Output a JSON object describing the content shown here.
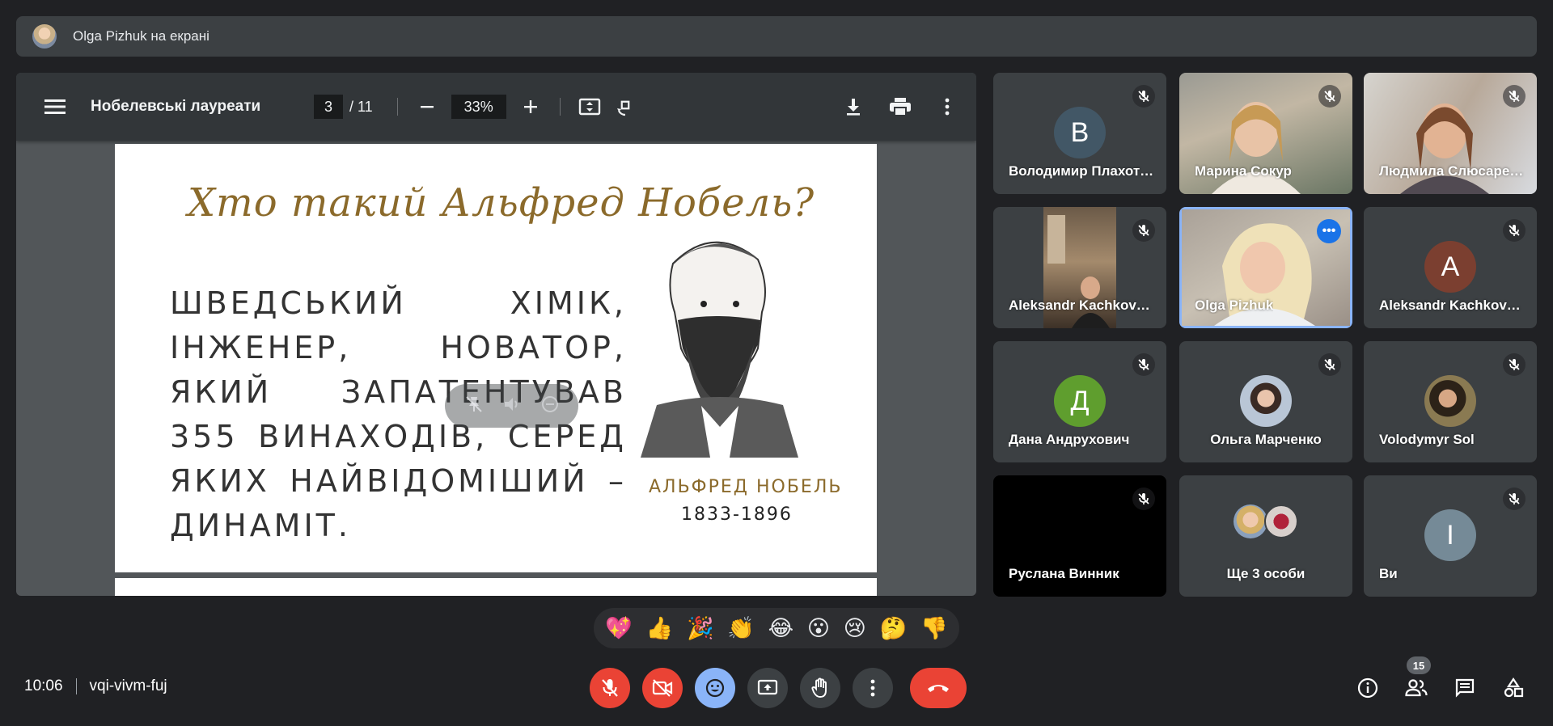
{
  "presenter": {
    "text": "Olga Pizhuk на екрані"
  },
  "pdf": {
    "title": "Нобелевські лауреати",
    "current_page": "3",
    "total_pages": "/ 11",
    "zoom": "33%"
  },
  "slide": {
    "title": "Хто такий Альфред Нобель?",
    "body": "ШВЕДСЬКИЙ ХІМІК, ІНЖЕНЕР, НОВАТОР, ЯКИЙ ЗАПАТЕНТУВАВ 355 ВИНАХОДІВ, СЕРЕД ЯКИХ НАЙВІДОМІШИЙ – ДИНАМІТ.",
    "portrait_name": "АЛЬФРЕД НОБЕЛЬ",
    "portrait_years": "1833-1896"
  },
  "participants": [
    {
      "name": "Володимир Плахотнюк",
      "initial": "В",
      "avatar_color": "#425766"
    },
    {
      "name": "Марина Сокур"
    },
    {
      "name": "Людмила Слюсаренко"
    },
    {
      "name": "Aleksandr Kachkovskyi"
    },
    {
      "name": "Olga Pizhuk"
    },
    {
      "name": "Aleksandr Kachkovskyi",
      "initial": "A",
      "avatar_color": "#7b3f30"
    },
    {
      "name": "Дана Андрухович",
      "initial": "Д",
      "avatar_color": "#5f9e2e"
    },
    {
      "name": "Ольга Марченко"
    },
    {
      "name": "Volodymyr Sol"
    },
    {
      "name": "Руслана Винник"
    },
    {
      "name": "Ще 3 особи"
    },
    {
      "name": "Ви",
      "initial": "І",
      "avatar_color": "#758a97"
    }
  ],
  "reactions": [
    "💖",
    "👍",
    "🎉",
    "👏",
    "😂",
    "😮",
    "😢",
    "🤔",
    "👎"
  ],
  "meeting": {
    "time": "10:06",
    "code": "vqi-vivm-fuj"
  },
  "people_count": "15",
  "colors": {
    "accent": "#8ab4f8",
    "danger": "#ea4335",
    "surface": "#3c4043",
    "background": "#202124"
  }
}
